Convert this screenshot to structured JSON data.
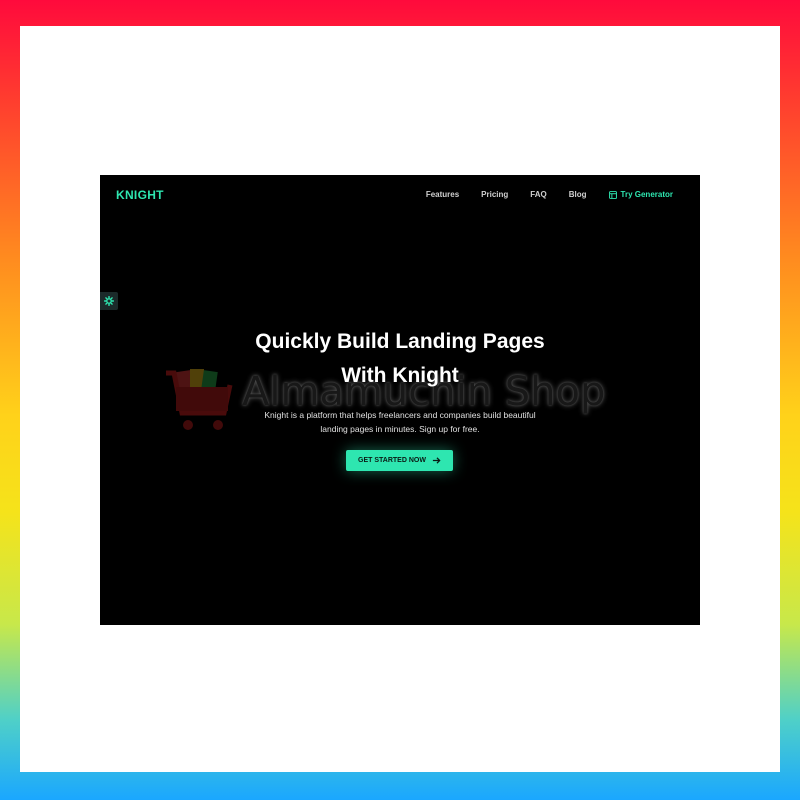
{
  "brand": {
    "logo": "KNIGHT",
    "accent": "#2ee6b0"
  },
  "nav": {
    "links": [
      "Features",
      "Pricing",
      "FAQ",
      "Blog"
    ],
    "cta": "Try Generator",
    "cta_icon": "layout-icon"
  },
  "settings": {
    "icon": "gear-icon"
  },
  "hero": {
    "title_line1": "Quickly Build Landing Pages",
    "title_line2": "With Knight",
    "subtitle_line1": "Knight is a platform that helps freelancers and companies build beautiful",
    "subtitle_line2": "landing pages in minutes. Sign up for free.",
    "button": "GET STARTED NOW",
    "button_icon": "arrow-right-icon"
  },
  "watermark": {
    "text": "Almamuchin Shop",
    "icon": "shopping-cart-icon"
  },
  "colors": {
    "background": "#000000",
    "frame_top": "#ff0a3c",
    "frame_bottom": "#1aa7ff"
  }
}
